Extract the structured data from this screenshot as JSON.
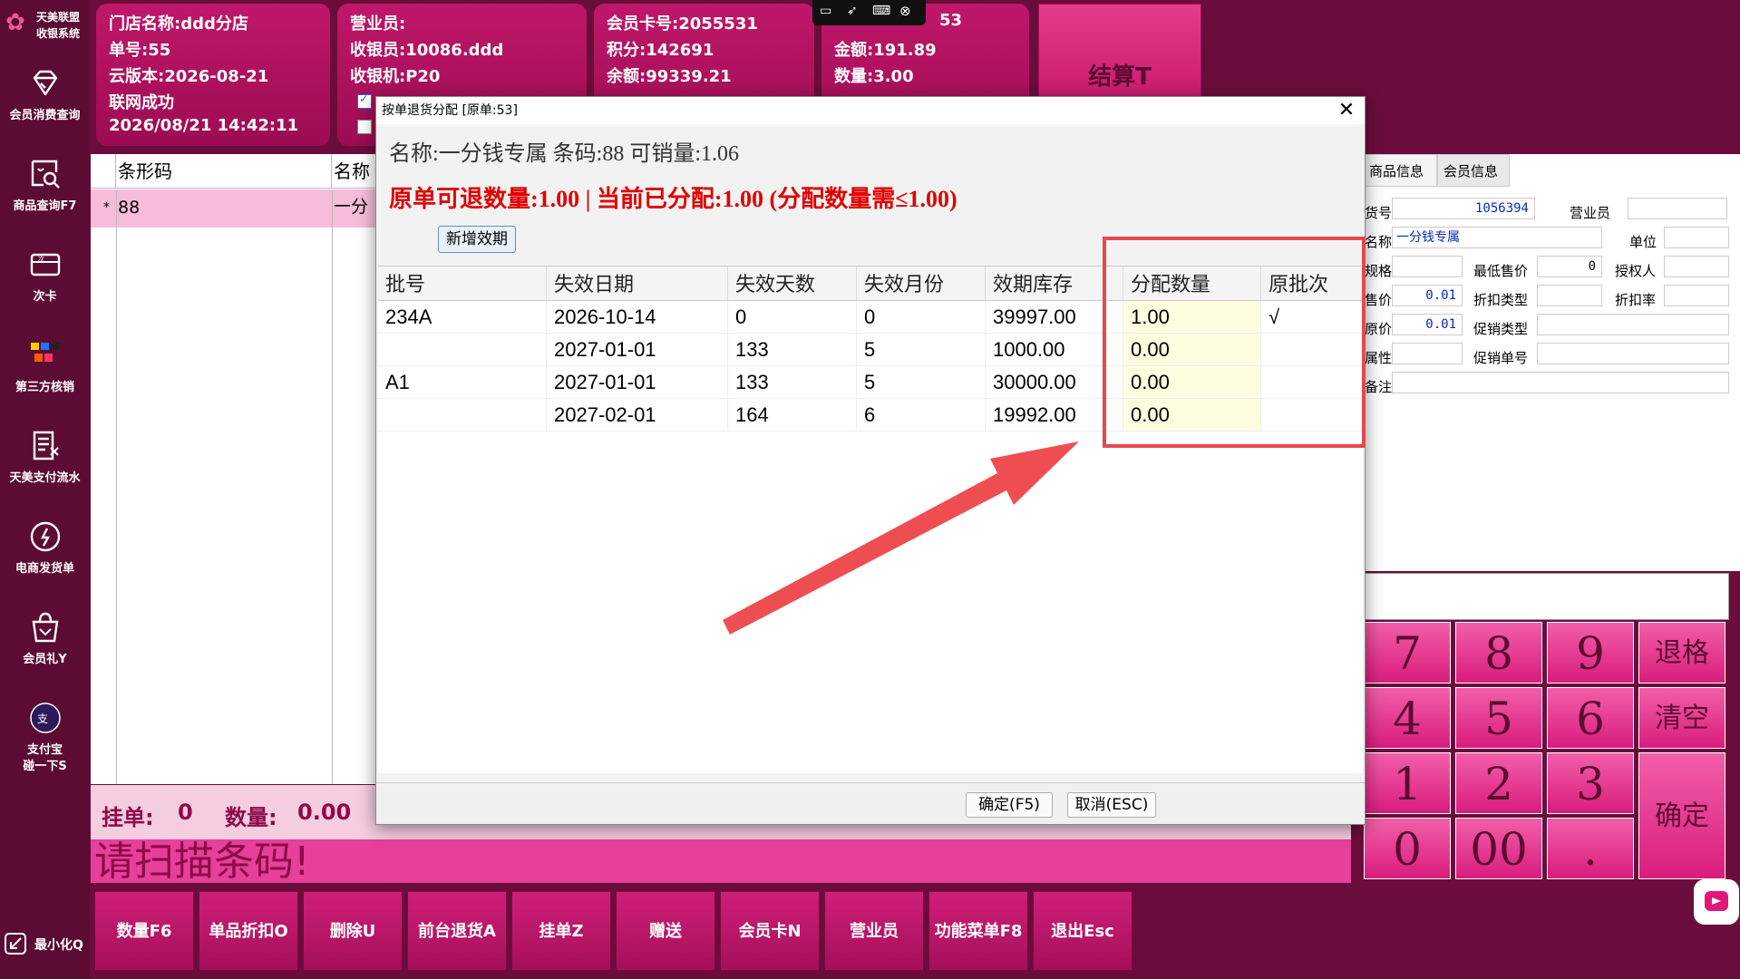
{
  "sidebar": {
    "logo_line1": "天美联盟",
    "logo_line2": "收银系统",
    "items": [
      {
        "label": "会员消费查询",
        "icon": "diamond-icon"
      },
      {
        "label": "商品查询F7",
        "icon": "product-search-icon"
      },
      {
        "label": "次卡",
        "icon": "card-icon"
      },
      {
        "label": "第三方核销",
        "icon": "third-party-apps-icon"
      },
      {
        "label": "天美支付流水",
        "icon": "payment-flow-icon"
      },
      {
        "label": "电商发货单",
        "icon": "ecommerce-icon"
      },
      {
        "label": "会员礼Y",
        "icon": "gift-bag-icon"
      },
      {
        "label": "支付宝",
        "label2": "碰一下S",
        "icon": "alipay-icon"
      }
    ],
    "minimize_label": "最小化Q"
  },
  "header": {
    "store": {
      "line1": "门店名称:ddd分店",
      "line2": "单号:55",
      "line3": "云版本:2026-08-21",
      "line4": "联网成功",
      "line5": "2026/08/21 14:42:11"
    },
    "staff": {
      "line1": "营业员:",
      "line2": "收银员:10086.ddd",
      "line3": "收银机:P20"
    },
    "member": {
      "line1": "会员卡号:2055531",
      "line2": "积分:142691",
      "line3": "余额:99339.21"
    },
    "totals": {
      "line1": "53",
      "line2": "金额:191.89",
      "line3": "数量:3.00"
    },
    "settle_label": "结算T"
  },
  "grid": {
    "col_barcode": "条形码",
    "col_name": "名称",
    "row_marker": "*",
    "row_barcode": "88",
    "row_name": "一分"
  },
  "status": {
    "pending_label": "挂单:",
    "pending_value": "0",
    "qty_label": "数量:",
    "qty_value": "0.00"
  },
  "scan_prompt": "请扫描条码!",
  "bottom_buttons": [
    "数量F6",
    "单品折扣O",
    "删除U",
    "前台退货A",
    "挂单Z",
    "赠送",
    "会员卡N",
    "营业员",
    "功能菜单F8",
    "退出Esc"
  ],
  "right_panel": {
    "tab_product": "商品信息",
    "tab_member": "会员信息",
    "code_label": "货号",
    "code_value": "1056394",
    "salesman_label": "营业员",
    "name_label": "名称",
    "name_value": "一分钱专属",
    "unit_label": "单位",
    "spec_label": "规格",
    "min_price_label": "最低售价",
    "min_price_value": "0",
    "auth_label": "授权人",
    "sale_price_label": "售价",
    "sale_price_value": "0.01",
    "discount_type_label": "折扣类型",
    "discount_rate_label": "折扣率",
    "orig_price_label": "原价",
    "orig_price_value": "0.01",
    "promo_type_label": "促销类型",
    "attr_label": "属性",
    "promo_no_label": "促销单号",
    "remark_label": "备注"
  },
  "keypad": {
    "k7": "7",
    "k8": "8",
    "k9": "9",
    "back": "退格",
    "k4": "4",
    "k5": "5",
    "k6": "6",
    "clear": "清空",
    "k1": "1",
    "k2": "2",
    "k3": "3",
    "ok": "确定",
    "k0": "0",
    "k00": "00",
    "dot": "."
  },
  "dialog": {
    "title": "按单退货分配 [原单:53]",
    "close": "✕",
    "info": "名称:一分钱专属 条码:88 可销量:1.06",
    "warning": "原单可退数量:1.00 | 当前已分配:1.00 (分配数量需≤1.00)",
    "add_button": "新增效期",
    "columns": [
      "批号",
      "失效日期",
      "失效天数",
      "失效月份",
      "效期库存",
      "分配数量",
      "原批次"
    ],
    "rows": [
      {
        "batch": "234A",
        "expiry": "2026-10-14",
        "days": "0",
        "months": "0",
        "stock": "39997.00",
        "alloc": "1.00",
        "orig": "√"
      },
      {
        "batch": "",
        "expiry": "2027-01-01",
        "days": "133",
        "months": "5",
        "stock": "1000.00",
        "alloc": "0.00",
        "orig": ""
      },
      {
        "batch": "A1",
        "expiry": "2027-01-01",
        "days": "133",
        "months": "5",
        "stock": "30000.00",
        "alloc": "0.00",
        "orig": ""
      },
      {
        "batch": "",
        "expiry": "2027-02-01",
        "days": "164",
        "months": "6",
        "stock": "19992.00",
        "alloc": "0.00",
        "orig": ""
      }
    ],
    "confirm_label": "确定(F5)",
    "cancel_label": "取消(ESC)"
  },
  "colors": {
    "brand": "#c0176a",
    "annotation": "#e5484d",
    "warning_text": "#e10000"
  }
}
